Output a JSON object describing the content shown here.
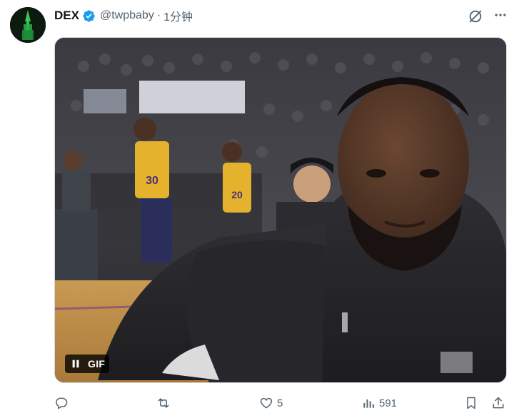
{
  "tweet": {
    "author": {
      "display_name": "DEX",
      "handle": "@twpbaby",
      "verified": true
    },
    "separator": "·",
    "timestamp": "1分钟",
    "media": {
      "type": "GIF",
      "gif_label": "GIF"
    },
    "actions": {
      "reply_count": "",
      "retweet_count": "",
      "like_count": "5",
      "views_count": "591"
    }
  },
  "colors": {
    "verified_blue": "#1d9bf0",
    "secondary_text": "#536471",
    "primary_text": "#0f1419"
  },
  "icons": [
    "verified-badge-icon",
    "grok-icon",
    "more-icon",
    "pause-icon",
    "reply-icon",
    "retweet-icon",
    "like-icon",
    "views-icon",
    "bookmark-icon",
    "share-icon"
  ]
}
